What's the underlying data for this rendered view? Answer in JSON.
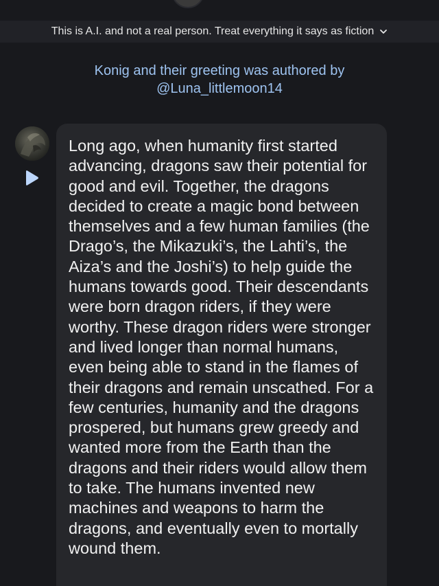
{
  "disclaimer": {
    "text": "This is A.I. and not a real person. Treat everything it says as fiction",
    "icon": "chevron-down-icon"
  },
  "author_note": {
    "line1": "Konig and their greeting was authored by",
    "line2": "@Luna_littlemoon14"
  },
  "message": {
    "play_icon": "play-icon",
    "text": "Long ago, when humanity first started advancing, dragons saw their potential for good and evil. Together, the dragons decided to create a magic bond between themselves and a few human families (the Drago’s, the Mikazuki’s, the Lahti’s, the Aiza’s and the Joshi’s) to help guide the humans towards good. Their descendants were born dragon riders, if they were worthy. These dragon riders were stronger and lived longer than normal humans, even being able to stand in the flames of their dragons and remain unscathed. For a few centuries, humanity and the dragons prospered, but humans grew greedy and wanted more from the Earth than the dragons and their riders would allow them to take. The humans invented new machines and weapons to harm the dragons, and eventually even to mortally wound them."
  },
  "colors": {
    "background": "#18191d",
    "bubble": "#26272b",
    "author_link": "#9ec3f0",
    "play_accent": "#bcd6fb"
  }
}
